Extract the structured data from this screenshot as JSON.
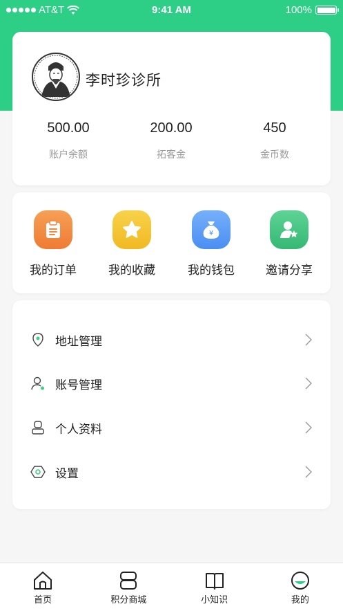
{
  "status_bar": {
    "carrier": "AT&T",
    "time": "9:41 AM",
    "battery": "100%"
  },
  "profile": {
    "name": "李时珍诊所"
  },
  "stats": [
    {
      "value": "500.00",
      "label": "账户余额"
    },
    {
      "value": "200.00",
      "label": "拓客金"
    },
    {
      "value": "450",
      "label": "金币数"
    }
  ],
  "quick_actions": [
    {
      "label": "我的订单",
      "icon": "clipboard-icon",
      "color": "#f38a3c"
    },
    {
      "label": "我的收藏",
      "icon": "star-icon",
      "color": "#f5c430"
    },
    {
      "label": "我的钱包",
      "icon": "money-bag-icon",
      "color": "#5b9bf5"
    },
    {
      "label": "邀请分享",
      "icon": "user-star-icon",
      "color": "#3dc17f"
    }
  ],
  "menu": [
    {
      "label": "地址管理",
      "icon": "location-pin-icon"
    },
    {
      "label": "账号管理",
      "icon": "user-account-icon"
    },
    {
      "label": "个人资料",
      "icon": "profile-icon"
    },
    {
      "label": "设置",
      "icon": "hexagon-settings-icon"
    }
  ],
  "tabs": [
    {
      "label": "首页",
      "icon": "home-icon"
    },
    {
      "label": "积分商城",
      "icon": "store-icon"
    },
    {
      "label": "小知识",
      "icon": "book-icon"
    },
    {
      "label": "我的",
      "icon": "smile-icon"
    }
  ],
  "colors": {
    "brand": "#2ccf85",
    "background": "#f6f6f6"
  }
}
